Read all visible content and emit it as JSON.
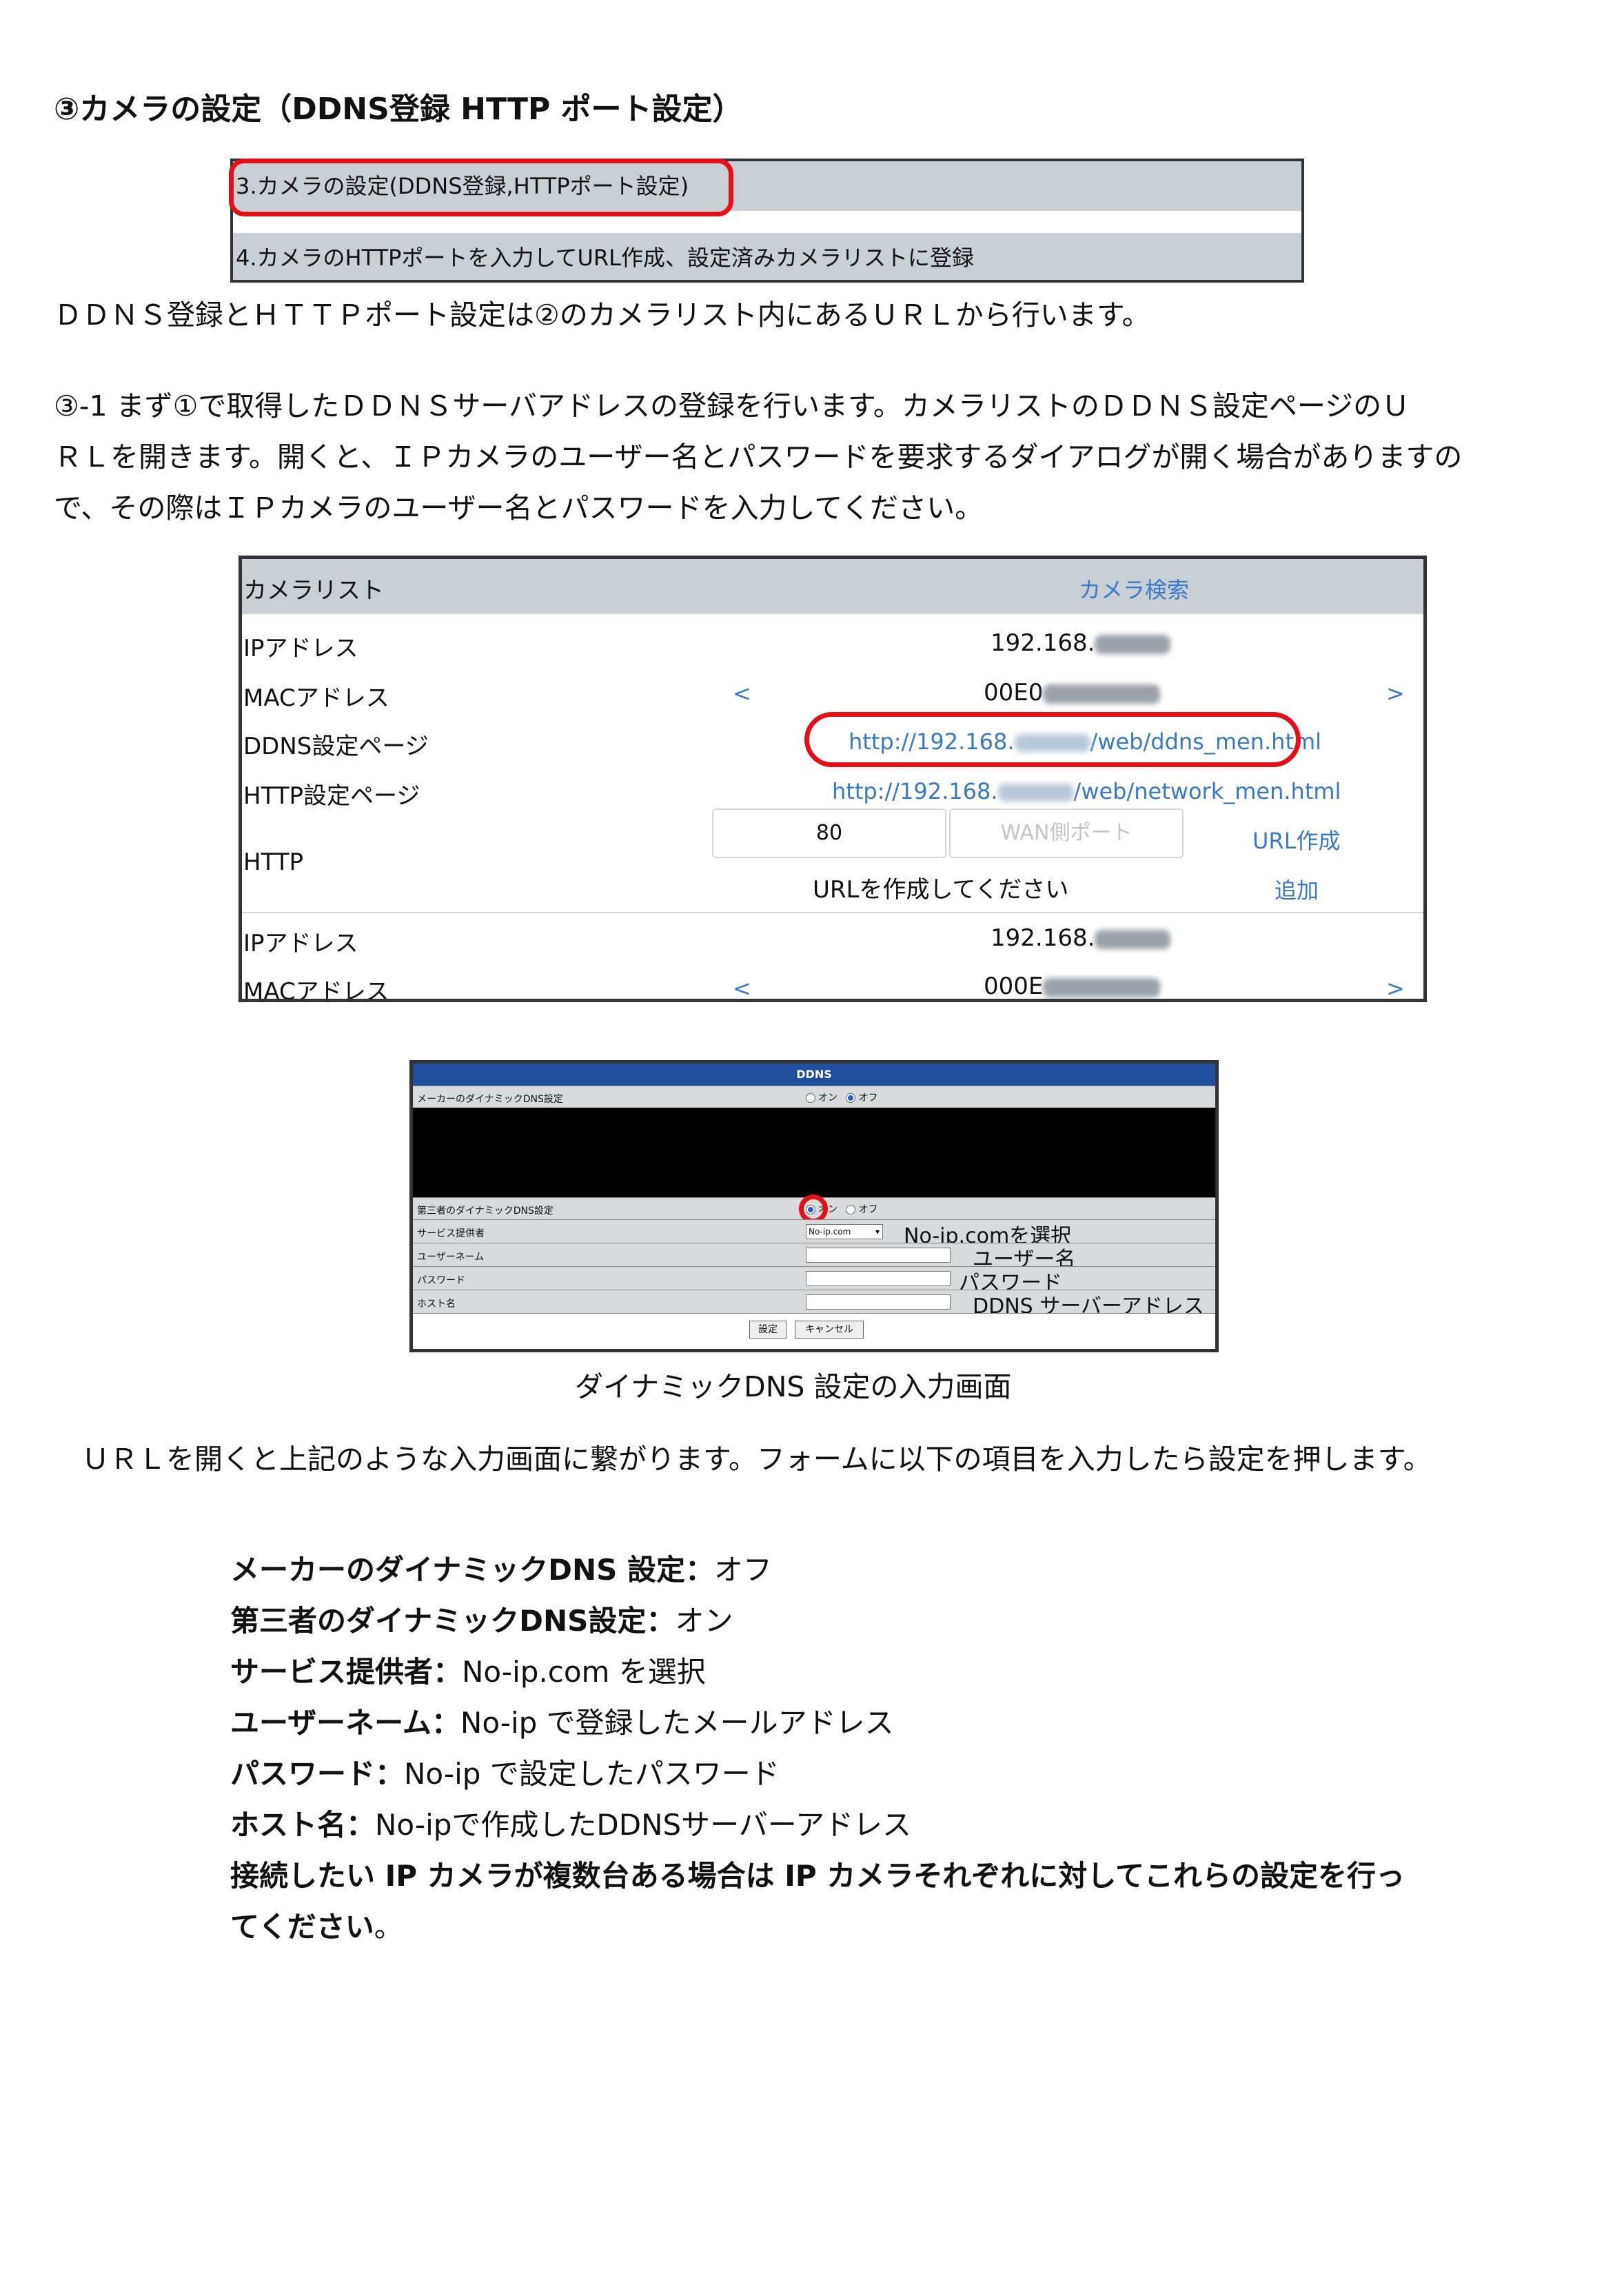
{
  "heading": "③カメラの設定（DDNS登録 HTTP ポート設定）",
  "steps": {
    "step3": "3.カメラの設定(DDNS登録,HTTPポート設定)",
    "step4": "4.カメラのHTTPポートを入力してURL作成、設定済みカメラリストに登録"
  },
  "intro": "ＤＤＮＳ登録とＨＴＴＰポート設定は②のカメラリスト内にあるＵＲＬから行います。",
  "step31": {
    "line1": "③-1 まず①で取得したＤＤＮＳサーバアドレスの登録を行います。カメラリストのＤＤＮＳ設定ページのＵ",
    "line2": "ＲＬを開きます。開くと、ＩＰカメラのユーザー名とパスワードを要求するダイアログが開く場合がありますの",
    "line3": "で、その際はＩＰカメラのユーザー名とパスワードを入力してください。"
  },
  "camera_list": {
    "title": "カメラリスト",
    "search_link": "カメラ検索",
    "ip_label": "IPアドレス",
    "ip_value": "192.168.",
    "mac_label": "MACアドレス",
    "mac_value": "00E0",
    "prev": "<",
    "next": ">",
    "ddns_label": "DDNS設定ページ",
    "ddns_url_a": "http://192.168.",
    "ddns_url_b": "/web/ddns_men.html",
    "http_label": "HTTP設定ページ",
    "http_url_a": "http://192.168.",
    "http_url_b": "/web/network_men.html",
    "port_label": "HTTP",
    "port_value": "80",
    "wan_placeholder": "WAN側ポート",
    "url_create": "URL作成",
    "url_prompt": "URLを作成してください",
    "add": "追加",
    "ip_label2": "IPアドレス",
    "ip_value2": "192.168.",
    "mac_label2": "MACアドレス",
    "mac_value2": "000E"
  },
  "ddns_form": {
    "title": "DDNS",
    "maker_label": "メーカーのダイナミックDNS設定",
    "on": "オン",
    "off": "オフ",
    "third_label": "第三者のダイナミックDNS設定",
    "provider_label": "サービス提供者",
    "provider_value": "No-ip.com",
    "user_label": "ユーザーネーム",
    "pass_label": "パスワード",
    "host_label": "ホスト名",
    "note_provider": "No-ip.comを選択",
    "note_user": "ユーザー名",
    "note_pass": "パスワード",
    "note_host": "DDNS サーバーアドレス",
    "btn_set": "設定",
    "btn_cancel": "キャンセル"
  },
  "caption": "ダイナミックDNS 設定の入力画面",
  "instruction": "ＵＲＬを開くと上記のような入力画面に繋がります。フォームに以下の項目を入力したら設定を押します。",
  "settings": [
    {
      "key": "メーカーのダイナミックDNS 設定：",
      "value": "オフ"
    },
    {
      "key": "第三者のダイナミックDNS設定：",
      "value": "オン"
    },
    {
      "key": "サービス提供者：",
      "value": "No-ip.com を選択"
    },
    {
      "key": "ユーザーネーム：",
      "value": "No-ip で登録したメールアドレス"
    },
    {
      "key": "パスワード：",
      "value": "No-ip で設定したパスワード"
    },
    {
      "key": "ホスト名：",
      "value": "No-ipで作成したDDNSサーバーアドレス"
    }
  ],
  "closing": {
    "line1": "接続したい IP カメラが複数台ある場合は IP カメラそれぞれに対してこれらの設定を行っ",
    "line2_bold": "てください",
    "line2_end": "。"
  },
  "colors": {
    "highlight": "#e3101a",
    "link": "#3a78c8",
    "header_gray": "#c8d0d6",
    "ddns_blue": "#1f4e9c"
  }
}
